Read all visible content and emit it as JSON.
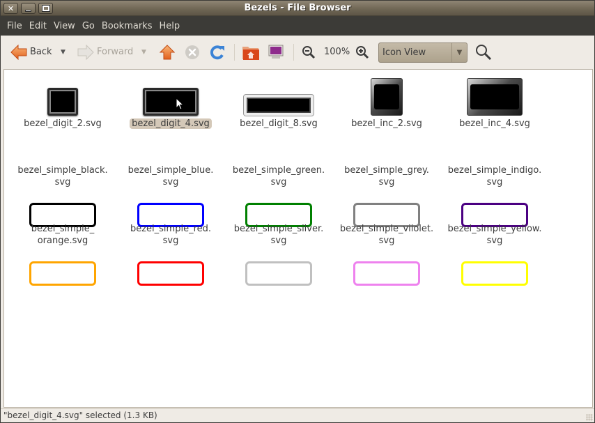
{
  "window": {
    "title": "Bezels - File Browser"
  },
  "menubar": {
    "items": [
      "File",
      "Edit",
      "View",
      "Go",
      "Bookmarks",
      "Help"
    ]
  },
  "toolbar": {
    "back_label": "Back",
    "forward_label": "Forward",
    "zoom_level": "100%",
    "view_mode": "Icon View",
    "icons": {
      "back": "back-arrow-icon",
      "forward": "forward-arrow-icon",
      "up": "up-arrow-icon",
      "stop": "stop-icon",
      "reload": "reload-icon",
      "home": "home-folder-icon",
      "computer": "computer-icon",
      "zoom_out": "zoom-out-icon",
      "zoom_in": "zoom-in-icon",
      "search": "search-icon"
    }
  },
  "files": [
    {
      "line1": "bezel_digit_2.svg",
      "line2": "",
      "kind": "digit",
      "selected": false
    },
    {
      "line1": "bezel_digit_4.svg",
      "line2": "",
      "kind": "digit",
      "selected": true
    },
    {
      "line1": "bezel_digit_8.svg",
      "line2": "",
      "kind": "digit",
      "selected": false
    },
    {
      "line1": "bezel_inc_2.svg",
      "line2": "",
      "kind": "inc",
      "selected": false
    },
    {
      "line1": "bezel_inc_4.svg",
      "line2": "",
      "kind": "inc",
      "selected": false
    },
    {
      "line1": "bezel_simple_black.",
      "line2": "svg",
      "kind": "simple",
      "color": "#000000",
      "selected": false
    },
    {
      "line1": "bezel_simple_blue.",
      "line2": "svg",
      "kind": "simple",
      "color": "#0000ff",
      "selected": false
    },
    {
      "line1": "bezel_simple_green.",
      "line2": "svg",
      "kind": "simple",
      "color": "#008000",
      "selected": false
    },
    {
      "line1": "bezel_simple_grey.",
      "line2": "svg",
      "kind": "simple",
      "color": "#808080",
      "selected": false
    },
    {
      "line1": "bezel_simple_indigo.",
      "line2": "svg",
      "kind": "simple",
      "color": "#4b0082",
      "selected": false
    },
    {
      "line1": "bezel_simple_",
      "line2": "orange.svg",
      "kind": "simple",
      "color": "#ffa500",
      "selected": false
    },
    {
      "line1": "bezel_simple_red.",
      "line2": "svg",
      "kind": "simple",
      "color": "#ff0000",
      "selected": false
    },
    {
      "line1": "bezel_simple_silver.",
      "line2": "svg",
      "kind": "simple",
      "color": "#c0c0c0",
      "selected": false
    },
    {
      "line1": "bezel_simple_viiolet.",
      "line2": "svg",
      "kind": "simple",
      "color": "#ee82ee",
      "selected": false
    },
    {
      "line1": "bezel_simple_yellow.",
      "line2": "svg",
      "kind": "simple",
      "color": "#ffff00",
      "selected": false
    }
  ],
  "statusbar": {
    "text": "\"bezel_digit_4.svg\" selected (1.3 KB)"
  }
}
